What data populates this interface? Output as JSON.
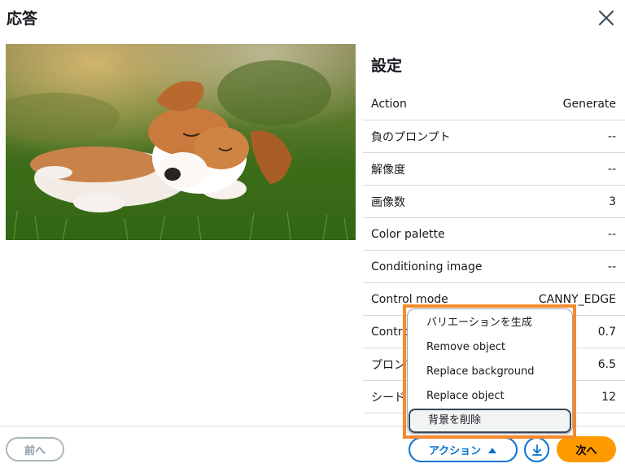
{
  "modal": {
    "title": "応答"
  },
  "icons": {
    "close": "close-icon",
    "download": "download-icon",
    "caret": "caret-up-icon"
  },
  "settings": {
    "title": "設定",
    "rows": [
      {
        "label": "Action",
        "value": "Generate"
      },
      {
        "label": "負のプロンプト",
        "value": "--"
      },
      {
        "label": "解像度",
        "value": "--"
      },
      {
        "label": "画像数",
        "value": "3"
      },
      {
        "label": "Color palette",
        "value": "--"
      },
      {
        "label": "Conditioning image",
        "value": "--"
      },
      {
        "label": "Control mode",
        "value": "CANNY_EDGE"
      },
      {
        "label": "Control strength",
        "value": "0.7"
      },
      {
        "label": "プロンプト強度",
        "value": "6.5"
      },
      {
        "label": "シード",
        "value": "12"
      }
    ]
  },
  "menu": {
    "items": [
      {
        "label": "バリエーションを生成"
      },
      {
        "label": "Remove object"
      },
      {
        "label": "Replace background"
      },
      {
        "label": "Replace object"
      },
      {
        "label": "背景を削除"
      }
    ]
  },
  "footer": {
    "prev_label": "前へ",
    "actions_label": "アクション",
    "next_label": "次へ"
  },
  "colors": {
    "primary": "#ff9900",
    "link": "#0972d3",
    "highlight": "#f58a2c"
  }
}
